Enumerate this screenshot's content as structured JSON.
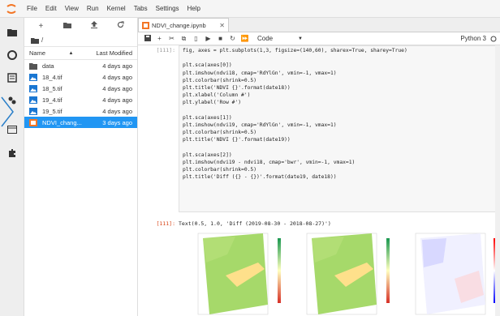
{
  "menubar": {
    "items": [
      "File",
      "Edit",
      "View",
      "Run",
      "Kernel",
      "Tabs",
      "Settings",
      "Help"
    ]
  },
  "filebrowser": {
    "path": "/",
    "header": {
      "name": "Name",
      "modified": "Last Modified"
    },
    "rows": [
      {
        "name": "data",
        "modified": "4 days ago",
        "type": "folder"
      },
      {
        "name": "18_4.tif",
        "modified": "4 days ago",
        "type": "image"
      },
      {
        "name": "18_5.tif",
        "modified": "4 days ago",
        "type": "image"
      },
      {
        "name": "19_4.tif",
        "modified": "4 days ago",
        "type": "image"
      },
      {
        "name": "19_5.tif",
        "modified": "4 days ago",
        "type": "image"
      },
      {
        "name": "NDVI_chang...",
        "modified": "3 days ago",
        "type": "notebook",
        "selected": true
      }
    ]
  },
  "tab": {
    "label": "NDVI_change.ipynb"
  },
  "nbtoolbar": {
    "cell_type": "Code",
    "kernel": "Python 3"
  },
  "cells": {
    "in_prompt": "[111]:",
    "out_prompt": "[111]:",
    "code_lines": [
      "fig, axes = plt.subplots(1,3, figsize=(140,60), sharex=True, sharey=True)",
      "",
      "plt.sca(axes[0])",
      "plt.imshow(ndvi18, cmap='RdYlGn', vmin=-1, vmax=1)",
      "plt.colorbar(shrink=0.5)",
      "plt.title('NDVI {}'.format(date18))",
      "plt.xlabel('Column #')",
      "plt.ylabel('Row #')",
      "",
      "plt.sca(axes[1])",
      "plt.imshow(ndvi19, cmap='RdYlGn', vmin=-1, vmax=1)",
      "plt.colorbar(shrink=0.5)",
      "plt.title('NDVI {}'.format(date19))",
      "",
      "plt.sca(axes[2])",
      "plt.imshow(ndvi19 - ndvi18, cmap='bwr', vmin=-1, vmax=1)",
      "plt.colorbar(shrink=0.5)",
      "plt.title('Diff ({} - {})'.format(date19, date18))"
    ],
    "output_text": "Text(0.5, 1.0, 'Diff (2019-08-30 - 2018-08-27)')"
  },
  "colors": {
    "accent": "#2196f3",
    "ndvi_green": "#a6d96a",
    "ndvi_yellow": "#fee08b",
    "diff_white": "#f5f5ff"
  }
}
